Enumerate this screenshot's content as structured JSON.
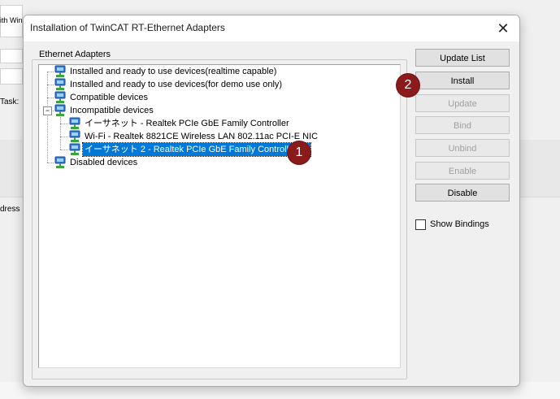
{
  "background": {
    "fragments": [
      "ith Win",
      "Task:",
      "dress"
    ]
  },
  "dialog": {
    "title": "Installation of TwinCAT RT-Ethernet Adapters",
    "close_glyph": "✕",
    "group_label": "Ethernet Adapters",
    "tree": [
      {
        "label": "Installed and ready to use devices(realtime capable)",
        "icon": "network-adapter-icon"
      },
      {
        "label": "Installed and ready to use devices(for demo use only)",
        "icon": "network-adapter-icon"
      },
      {
        "label": "Compatible devices",
        "icon": "network-adapter-icon"
      },
      {
        "label": "Incompatible devices",
        "icon": "network-adapter-icon",
        "expander": "−"
      },
      {
        "label": "イーサネット - Realtek PCIe GbE Family Controller",
        "icon": "network-adapter-icon"
      },
      {
        "label": "Wi-Fi - Realtek 8821CE Wireless LAN 802.11ac PCI-E NIC",
        "icon": "network-adapter-icon"
      },
      {
        "label": "イーサネット 2 - Realtek PCIe GbE Family Controller #2",
        "icon": "network-adapter-icon",
        "selected": true
      },
      {
        "label": "Disabled devices",
        "icon": "network-adapter-icon"
      }
    ],
    "buttons": {
      "update_list": "Update List",
      "install": "Install",
      "update": "Update",
      "bind": "Bind",
      "unbind": "Unbind",
      "enable": "Enable",
      "disable": "Disable"
    },
    "show_bindings_label": "Show Bindings",
    "show_bindings_checked": false
  },
  "markers": {
    "one": "1",
    "two": "2"
  },
  "colors": {
    "selection": "#0078d7",
    "marker": "#8b1a1a",
    "icon_blue": "#2f7bd8",
    "icon_green": "#3aa63a"
  }
}
